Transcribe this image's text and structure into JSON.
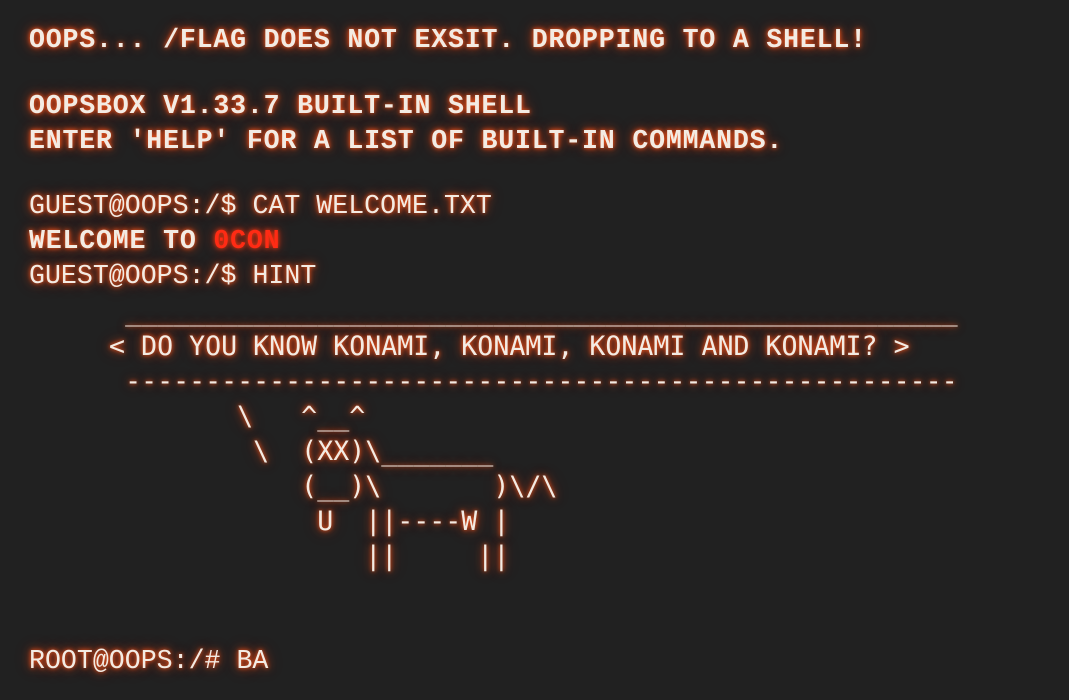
{
  "terminal": {
    "error_line": "OOPS... /FLAG DOES NOT EXSIT. DROPPING TO A SHELL!",
    "banner_line1": "OOPSBOX V1.33.7 BUILT-IN SHELL",
    "banner_line2": "ENTER 'HELP' FOR A LIST OF BUILT-IN COMMANDS.",
    "guest_prompt": "GUEST@OOPS:/$ ",
    "command_cat": "CAT WELCOME.TXT",
    "welcome_prefix": "WELCOME TO ",
    "welcome_highlight": "0CON",
    "command_hint": "HINT",
    "cowsay_art": "      ____________________________________________________\n     < DO YOU KNOW KONAMI, KONAMI, KONAMI AND KONAMI? >\n      ----------------------------------------------------\n             \\   ^__^\n              \\  (XX)\\_______\n                 (__)\\       )\\/\\\n                  U  ||----W |\n                     ||     ||",
    "root_prompt": "ROOT@OOPS:/# ",
    "root_input": "BA",
    "colors": {
      "background": "#212121",
      "text": "#f3ebe3",
      "glow": "#ff5a1c",
      "highlight": "#ff2b14"
    }
  }
}
